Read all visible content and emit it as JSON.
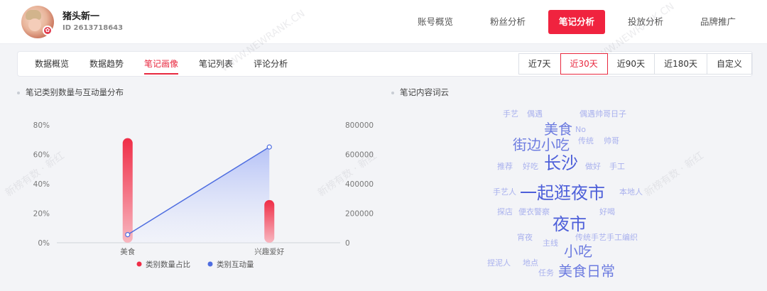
{
  "profile": {
    "name": "猪头新一",
    "id": "ID 2613718643"
  },
  "nav": [
    "账号概览",
    "粉丝分析",
    "笔记分析",
    "投放分析",
    "品牌推广"
  ],
  "nav_active": 2,
  "subtabs": [
    "数据概览",
    "数据趋势",
    "笔记画像",
    "笔记列表",
    "评论分析"
  ],
  "subtab_active": 2,
  "ranges": [
    "近7天",
    "近30天",
    "近90天",
    "近180天",
    "自定义"
  ],
  "range_active": 1,
  "sections": {
    "chart_title": "笔记类别数量与互动量分布",
    "cloud_title": "笔记内容词云"
  },
  "watermarks": [
    "WWW.NEWRANK.CN",
    "新榜有数 · 新红"
  ],
  "chart_data": {
    "type": "bar",
    "categories": [
      "美食",
      "兴趣爱好"
    ],
    "series": [
      {
        "name": "类别数量占比",
        "type": "bar",
        "axis": "left",
        "values": [
          0.71,
          0.29
        ],
        "color": "#ef2d47"
      },
      {
        "name": "类别互动量",
        "type": "line",
        "axis": "right",
        "values": [
          55000,
          650000
        ],
        "color": "#4e6de0"
      }
    ],
    "y_left": {
      "ticks": [
        "0%",
        "20%",
        "40%",
        "60%",
        "80%"
      ],
      "range": [
        0,
        0.8
      ]
    },
    "y_right": {
      "ticks": [
        "0",
        "200000",
        "400000",
        "600000",
        "800000"
      ],
      "range": [
        0,
        800000
      ]
    },
    "legend": "bottom"
  },
  "wordcloud": [
    {
      "text": "手艺",
      "size": 11,
      "color": "#a9b1ee"
    },
    {
      "text": "偶遇",
      "size": 11,
      "color": "#a9b1ee"
    },
    {
      "text": "偶遇帅哥日子",
      "size": 11,
      "color": "#a9b1ee"
    },
    {
      "text": "美食",
      "size": 20,
      "color": "#6d7ce0"
    },
    {
      "text": "No",
      "size": 11,
      "color": "#a9b1ee"
    },
    {
      "text": "街边小吃",
      "size": 20,
      "color": "#6d7ce0"
    },
    {
      "text": "传统",
      "size": 11,
      "color": "#a9b1ee"
    },
    {
      "text": "帅哥",
      "size": 11,
      "color": "#a9b1ee"
    },
    {
      "text": "推荐",
      "size": 11,
      "color": "#a9b1ee"
    },
    {
      "text": "好吃",
      "size": 11,
      "color": "#a9b1ee"
    },
    {
      "text": "长沙",
      "size": 24,
      "color": "#4d5fd9"
    },
    {
      "text": "做好",
      "size": 11,
      "color": "#a9b1ee"
    },
    {
      "text": "手工",
      "size": 11,
      "color": "#a9b1ee"
    },
    {
      "text": "手艺人",
      "size": 11,
      "color": "#a9b1ee"
    },
    {
      "text": "一起逛夜市",
      "size": 24,
      "color": "#4d5fd9"
    },
    {
      "text": "本地人",
      "size": 11,
      "color": "#a9b1ee"
    },
    {
      "text": "探店",
      "size": 11,
      "color": "#a9b1ee"
    },
    {
      "text": "便衣警察",
      "size": 11,
      "color": "#a9b1ee"
    },
    {
      "text": "好喝",
      "size": 11,
      "color": "#a9b1ee"
    },
    {
      "text": "夜市",
      "size": 24,
      "color": "#4d5fd9"
    },
    {
      "text": "宵夜",
      "size": 11,
      "color": "#a9b1ee"
    },
    {
      "text": "主线",
      "size": 11,
      "color": "#a9b1ee"
    },
    {
      "text": "传统手艺手工编织",
      "size": 11,
      "color": "#a9b1ee"
    },
    {
      "text": "小吃",
      "size": 20,
      "color": "#6d7ce0"
    },
    {
      "text": "捏泥人",
      "size": 11,
      "color": "#a9b1ee"
    },
    {
      "text": "地点",
      "size": 11,
      "color": "#a9b1ee"
    },
    {
      "text": "任务",
      "size": 11,
      "color": "#a9b1ee"
    },
    {
      "text": "美食日常",
      "size": 20,
      "color": "#6d7ce0"
    }
  ]
}
